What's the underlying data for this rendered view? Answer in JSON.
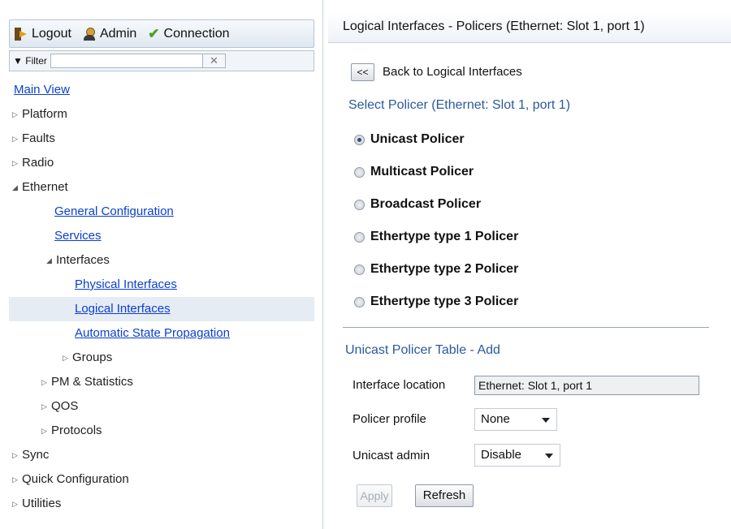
{
  "toolbar": {
    "logout": "Logout",
    "admin": "Admin",
    "connection": "Connection"
  },
  "filter": {
    "label": "Filter",
    "value": "",
    "clear": "✕"
  },
  "tree": {
    "main_view": "Main View",
    "platform": "Platform",
    "faults": "Faults",
    "radio": "Radio",
    "ethernet": "Ethernet",
    "general_configuration": "General Configuration",
    "services": "Services",
    "interfaces": "Interfaces",
    "physical_interfaces": "Physical Interfaces",
    "logical_interfaces": "Logical Interfaces",
    "automatic_state_propagation": "Automatic State Propagation",
    "groups": "Groups",
    "pm_statistics": "PM & Statistics",
    "qos": "QOS",
    "protocols": "Protocols",
    "sync": "Sync",
    "quick_configuration": "Quick Configuration",
    "utilities": "Utilities",
    "selected": "Logical Interfaces"
  },
  "main": {
    "title": "Logical Interfaces - Policers (Ethernet: Slot 1, port 1)",
    "back_button": "<<",
    "back_label": "Back to Logical Interfaces",
    "select_title": "Select Policer (Ethernet: Slot 1, port 1)",
    "policers": [
      {
        "label": "Unicast Policer",
        "selected": true
      },
      {
        "label": "Multicast Policer",
        "selected": false
      },
      {
        "label": "Broadcast Policer",
        "selected": false
      },
      {
        "label": "Ethertype type 1 Policer",
        "selected": false
      },
      {
        "label": "Ethertype type 2 Policer",
        "selected": false
      },
      {
        "label": "Ethertype type 3 Policer",
        "selected": false
      }
    ],
    "table_title": "Unicast Policer Table - Add",
    "form": {
      "interface_location_label": "Interface location",
      "interface_location_value": "Ethernet: Slot 1, port 1",
      "policer_profile_label": "Policer profile",
      "policer_profile_value": "None",
      "unicast_admin_label": "Unicast admin",
      "unicast_admin_value": "Disable"
    },
    "apply_button": "Apply",
    "refresh_button": "Refresh"
  },
  "colors": {
    "link": "#0a3fcf",
    "section_title": "#2b5a9b",
    "selected_row": "#e6ecf4"
  }
}
